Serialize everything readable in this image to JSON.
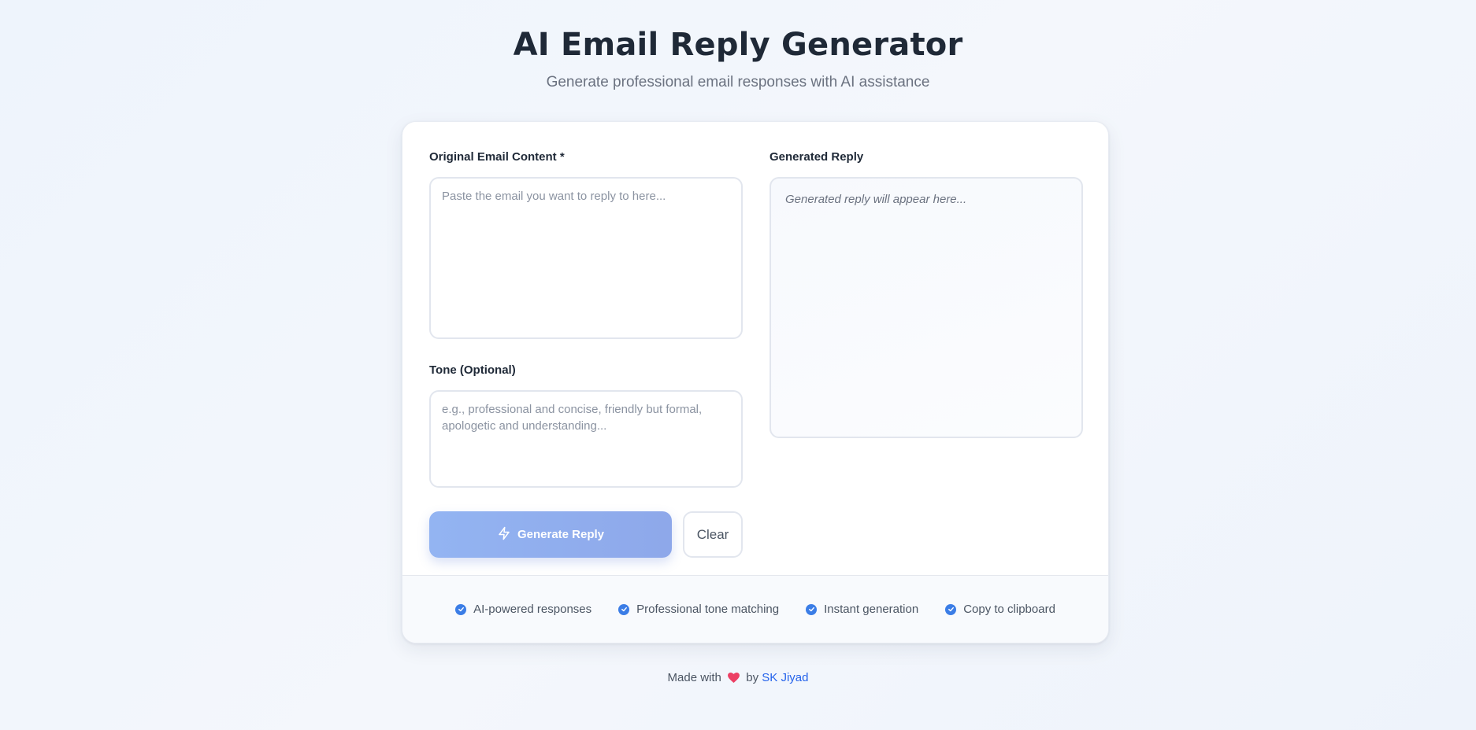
{
  "header": {
    "title": "AI Email Reply Generator",
    "subtitle": "Generate professional email responses with AI assistance"
  },
  "form": {
    "email_label": "Original Email Content *",
    "email_placeholder": "Paste the email you want to reply to here...",
    "tone_label": "Tone (Optional)",
    "tone_placeholder": "e.g., professional and concise, friendly but formal, apologetic and understanding...",
    "generate_label": "Generate Reply",
    "clear_label": "Clear"
  },
  "reply": {
    "label": "Generated Reply",
    "placeholder": "Generated reply will appear here..."
  },
  "features": [
    "AI-powered responses",
    "Professional tone matching",
    "Instant generation",
    "Copy to clipboard"
  ],
  "footer": {
    "made_with": "Made with",
    "by": "by",
    "author": "SK Jiyad"
  },
  "colors": {
    "accent": "#3b7de6",
    "button": "#93b4f2",
    "heart": "#ec3f64"
  },
  "icons": {
    "generate": "lightning-icon",
    "feature": "check-circle-icon",
    "heart": "heart-icon"
  }
}
